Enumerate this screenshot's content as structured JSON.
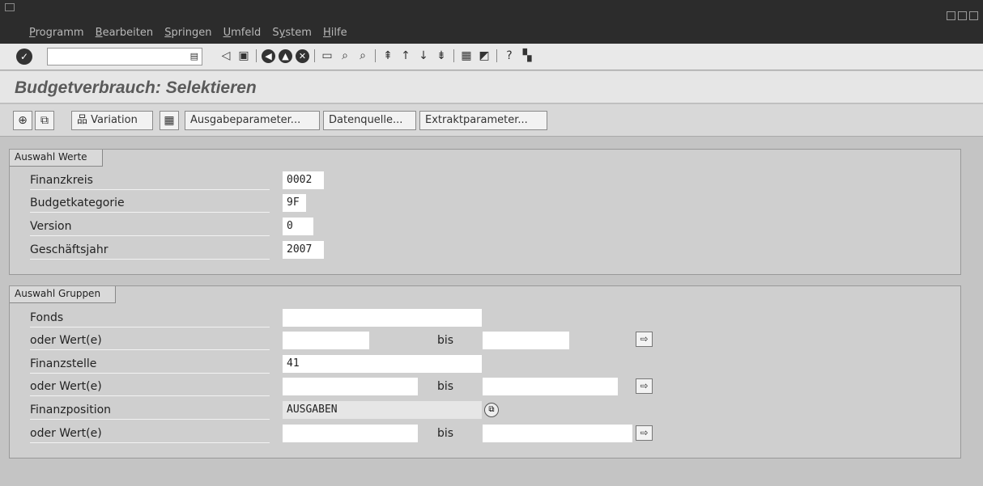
{
  "menu": {
    "items": [
      {
        "accel": "P",
        "rest": "rogramm"
      },
      {
        "accel": "B",
        "rest": "earbeiten"
      },
      {
        "accel": "S",
        "rest": "pringen"
      },
      {
        "accel": "U",
        "rest": "mfeld"
      },
      {
        "pre": "S",
        "accel": "y",
        "rest": "stem"
      },
      {
        "accel": "H",
        "rest": "ilfe"
      }
    ]
  },
  "toolbar": {
    "command_value": "",
    "icons": [
      "back-icon",
      "save-icon",
      "nav-back-icon",
      "exit-icon",
      "cancel-icon",
      "print-icon",
      "find-icon",
      "find-next-icon",
      "first-page-icon",
      "prev-page-icon",
      "next-page-icon",
      "last-page-icon",
      "new-session-icon",
      "shortcut-icon",
      "help-icon",
      "layout-icon"
    ]
  },
  "title": "Budgetverbrauch: Selektieren",
  "app_toolbar": {
    "variation": "Variation",
    "ausgabeparameter": "Ausgabeparameter...",
    "datenquelle": "Datenquelle...",
    "extraktparameter": "Extraktparameter..."
  },
  "group1": {
    "title": "Auswahl Werte",
    "rows": [
      {
        "label": "Finanzkreis",
        "value": "0002"
      },
      {
        "label": "Budgetkategorie",
        "value": "9F"
      },
      {
        "label": "Version",
        "value": "0"
      },
      {
        "label": "Geschäftsjahr",
        "value": "2007"
      }
    ]
  },
  "group2": {
    "title": "Auswahl Gruppen",
    "bis": "bis",
    "rows": [
      {
        "label": "Fonds",
        "value": ""
      },
      {
        "label": "oder Wert(e)",
        "from": "",
        "to": ""
      },
      {
        "label": "Finanzstelle",
        "value": "41"
      },
      {
        "label": "oder Wert(e)",
        "from": "",
        "to": ""
      },
      {
        "label": "Finanzposition",
        "value": "AUSGABEN"
      },
      {
        "label": "oder Wert(e)",
        "from": "",
        "to": ""
      }
    ]
  }
}
